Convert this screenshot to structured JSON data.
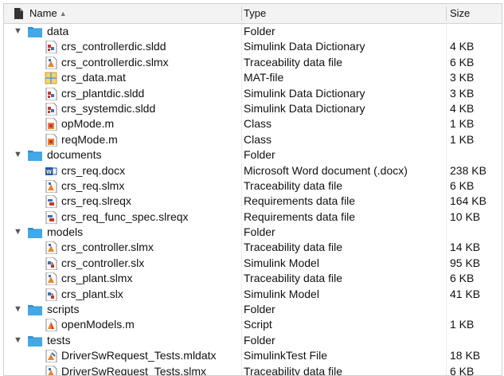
{
  "header": {
    "name_label": "Name",
    "sort_indicator": "▲",
    "type_label": "Type",
    "size_label": "Size"
  },
  "rows": [
    {
      "kind": "folder",
      "level": 0,
      "expanded": true,
      "icon": "folder-icon",
      "name": "data",
      "type": "Folder",
      "size": ""
    },
    {
      "kind": "file",
      "level": 1,
      "icon": "sldd-icon",
      "name": "crs_controllerdic.sldd",
      "type": "Simulink Data Dictionary",
      "size": "4 KB"
    },
    {
      "kind": "file",
      "level": 1,
      "icon": "slmx-icon",
      "name": "crs_controllerdic.slmx",
      "type": "Traceability data file",
      "size": "6 KB"
    },
    {
      "kind": "file",
      "level": 1,
      "icon": "mat-icon",
      "name": "crs_data.mat",
      "type": "MAT-file",
      "size": "3 KB"
    },
    {
      "kind": "file",
      "level": 1,
      "icon": "sldd-icon",
      "name": "crs_plantdic.sldd",
      "type": "Simulink Data Dictionary",
      "size": "3 KB"
    },
    {
      "kind": "file",
      "level": 1,
      "icon": "sldd-icon",
      "name": "crs_systemdic.sldd",
      "type": "Simulink Data Dictionary",
      "size": "4 KB"
    },
    {
      "kind": "file",
      "level": 1,
      "icon": "class-icon",
      "name": "opMode.m",
      "type": "Class",
      "size": "1 KB"
    },
    {
      "kind": "file",
      "level": 1,
      "icon": "class-icon",
      "name": "reqMode.m",
      "type": "Class",
      "size": "1 KB"
    },
    {
      "kind": "folder",
      "level": 0,
      "expanded": true,
      "icon": "folder-icon",
      "name": "documents",
      "type": "Folder",
      "size": ""
    },
    {
      "kind": "file",
      "level": 1,
      "icon": "word-doc-icon",
      "name": "crs_req.docx",
      "type": "Microsoft Word document (.docx)",
      "size": "238 KB"
    },
    {
      "kind": "file",
      "level": 1,
      "icon": "slmx-icon",
      "name": "crs_req.slmx",
      "type": "Traceability data file",
      "size": "6 KB"
    },
    {
      "kind": "file",
      "level": 1,
      "icon": "slreqx-icon",
      "name": "crs_req.slreqx",
      "type": "Requirements data file",
      "size": "164 KB"
    },
    {
      "kind": "file",
      "level": 1,
      "icon": "slreqx-icon",
      "name": "crs_req_func_spec.slreqx",
      "type": "Requirements data file",
      "size": "10 KB"
    },
    {
      "kind": "folder",
      "level": 0,
      "expanded": true,
      "icon": "folder-icon",
      "name": "models",
      "type": "Folder",
      "size": ""
    },
    {
      "kind": "file",
      "level": 1,
      "icon": "slmx-icon",
      "name": "crs_controller.slmx",
      "type": "Traceability data file",
      "size": "14 KB"
    },
    {
      "kind": "file",
      "level": 1,
      "icon": "slx-icon",
      "name": "crs_controller.slx",
      "type": "Simulink Model",
      "size": "95 KB"
    },
    {
      "kind": "file",
      "level": 1,
      "icon": "slmx-icon",
      "name": "crs_plant.slmx",
      "type": "Traceability data file",
      "size": "6 KB"
    },
    {
      "kind": "file",
      "level": 1,
      "icon": "slx-icon",
      "name": "crs_plant.slx",
      "type": "Simulink Model",
      "size": "41 KB"
    },
    {
      "kind": "folder",
      "level": 0,
      "expanded": true,
      "icon": "folder-icon",
      "name": "scripts",
      "type": "Folder",
      "size": ""
    },
    {
      "kind": "file",
      "level": 1,
      "icon": "script-icon",
      "name": "openModels.m",
      "type": "Script",
      "size": "1 KB"
    },
    {
      "kind": "folder",
      "level": 0,
      "expanded": true,
      "icon": "folder-icon",
      "name": "tests",
      "type": "Folder",
      "size": ""
    },
    {
      "kind": "file",
      "level": 1,
      "icon": "mldatx-icon",
      "name": "DriverSwRequest_Tests.mldatx",
      "type": "SimulinkTest File",
      "size": "18 KB"
    },
    {
      "kind": "file",
      "level": 1,
      "icon": "slmx-icon",
      "name": "DriverSwRequest_Tests.slmx",
      "type": "Traceability data file",
      "size": "6 KB"
    }
  ],
  "colors": {
    "folder": "#3fa4e0",
    "folder_tab": "#2f8fcf",
    "header_bg": "#f3f3f3",
    "simulink_red": "#c8362b",
    "simulink_blue": "#3b6fb6",
    "word_blue": "#2b579a",
    "matlab_orange": "#e8842c"
  }
}
